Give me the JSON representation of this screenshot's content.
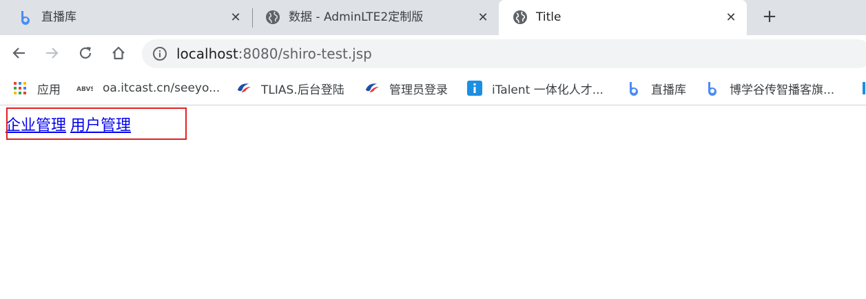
{
  "tabs": [
    {
      "title": "直播库",
      "icon": "bilibili-b-icon",
      "active": false
    },
    {
      "title": "数据 - AdminLTE2定制版",
      "icon": "globe-icon",
      "active": false
    },
    {
      "title": "Title",
      "icon": "globe-icon",
      "active": true
    }
  ],
  "toolbar": {
    "url_host": "localhost",
    "url_rest": ":8080/shiro-test.jsp"
  },
  "bookmarks": [
    {
      "label": "应用",
      "icon": "apps-grid-icon"
    },
    {
      "label": "oa.itcast.cn/seeyo...",
      "icon": "abvs-logo-icon"
    },
    {
      "label": "TLIAS.后台登陆",
      "icon": "tlias-logo-icon"
    },
    {
      "label": "管理员登录",
      "icon": "tlias-logo-icon"
    },
    {
      "label": "iTalent 一体化人才...",
      "icon": "italent-icon"
    },
    {
      "label": "直播库",
      "icon": "bilibili-b-icon"
    },
    {
      "label": "博学谷传智播客旗...",
      "icon": "bilibili-b-icon"
    }
  ],
  "page": {
    "links": [
      "企业管理",
      "用户管理"
    ]
  },
  "colors": {
    "link": "#0000ee",
    "highlight_border": "#e02020",
    "tabstrip_bg": "#dee1e6"
  }
}
